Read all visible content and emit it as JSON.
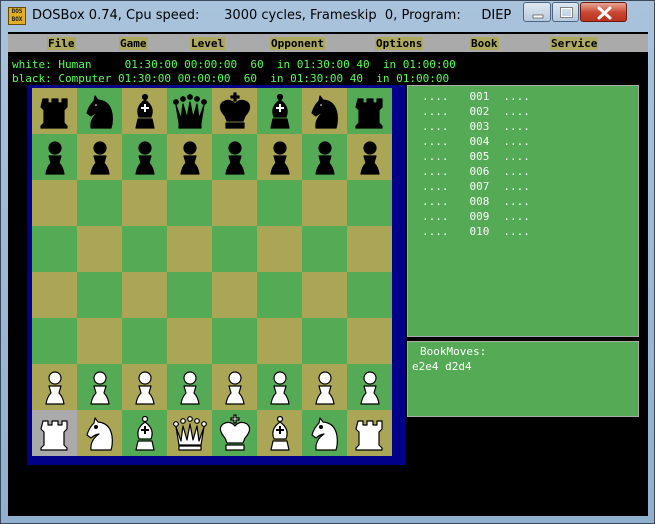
{
  "window": {
    "title": "DOSBox 0.74, Cpu speed:      3000 cycles, Frameskip  0, Program:     DIEP",
    "icon": "dosbox-icon",
    "icon_text": "DOS BOX"
  },
  "menu": [
    "File",
    "Game",
    "Level",
    "Opponent",
    "Options",
    "Book",
    "Service"
  ],
  "players": {
    "white_line": "white: Human     01:30:00 00:00:00  60  in 01:30:00 40  in 01:00:00",
    "black_line": "black: Computer 01:30:00 00:00:00  60  in 01:30:00 40  in 01:00:00"
  },
  "board": {
    "ranks": [
      [
        "bR",
        "bN",
        "bB",
        "bQ",
        "bK",
        "bB",
        "bN",
        "bR"
      ],
      [
        "bP",
        "bP",
        "bP",
        "bP",
        "bP",
        "bP",
        "bP",
        "bP"
      ],
      [
        "",
        "",
        "",
        "",
        "",
        "",
        "",
        ""
      ],
      [
        "",
        "",
        "",
        "",
        "",
        "",
        "",
        ""
      ],
      [
        "",
        "",
        "",
        "",
        "",
        "",
        "",
        ""
      ],
      [
        "",
        "",
        "",
        "",
        "",
        "",
        "",
        ""
      ],
      [
        "wP",
        "wP",
        "wP",
        "wP",
        "wP",
        "wP",
        "wP",
        "wP"
      ],
      [
        "wR",
        "wN",
        "wB",
        "wQ",
        "wK",
        "wB",
        "wN",
        "wR"
      ]
    ],
    "selected": [
      7,
      0
    ],
    "colors": {
      "light": "#aaa656",
      "dark": "#55aa55",
      "frame": "#000088",
      "selected": "#aaaaaa"
    }
  },
  "move_list": [
    {
      "white": "....",
      "num": "001",
      "black": "...."
    },
    {
      "white": "....",
      "num": "002",
      "black": "...."
    },
    {
      "white": "....",
      "num": "003",
      "black": "...."
    },
    {
      "white": "....",
      "num": "004",
      "black": "...."
    },
    {
      "white": "....",
      "num": "005",
      "black": "...."
    },
    {
      "white": "....",
      "num": "006",
      "black": "...."
    },
    {
      "white": "....",
      "num": "007",
      "black": "...."
    },
    {
      "white": "....",
      "num": "008",
      "black": "...."
    },
    {
      "white": "....",
      "num": "009",
      "black": "...."
    },
    {
      "white": "....",
      "num": "010",
      "black": "...."
    }
  ],
  "book": {
    "title": "BookMoves:",
    "moves": "e2e4 d2d4"
  }
}
